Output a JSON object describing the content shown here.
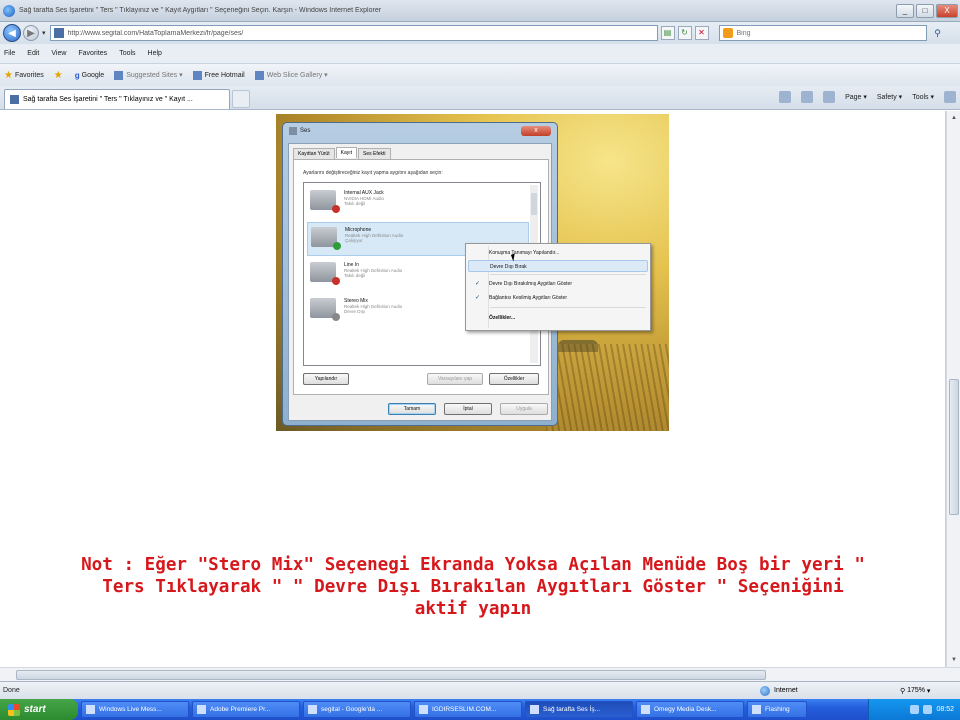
{
  "window": {
    "title": "Sağ tarafta Ses İşaretini \" Ters \" Tıklayınız ve \" Kayıt Aygıtları \" Seçeneğini Seçin. Karşın - Windows Internet Explorer",
    "minimize": "_",
    "maximize": "□",
    "close": "X"
  },
  "address": {
    "url": "http://www.segital.com/HataToplamaMerkezi/fr/page/ses/",
    "search_placeholder": "Bing"
  },
  "menu": [
    "File",
    "Edit",
    "View",
    "Favorites",
    "Tools",
    "Help"
  ],
  "favorites": {
    "label": "Favorites",
    "items": [
      "Google",
      "Suggested Sites ▾",
      "Free Hotmail",
      "Web Slice Gallery ▾"
    ]
  },
  "tab": {
    "label": "Sağ tarafta Ses İşaretini \" Ters \" Tıklayınız ve \" Kayıt ..."
  },
  "commands": [
    "Page ▾",
    "Safety ▾",
    "Tools ▾"
  ],
  "dialog": {
    "title": "Ses",
    "tabs": [
      "Kayıttan Yürüt",
      "Kayıt",
      "Ses Efekti"
    ],
    "instruction": "Ayarlarını değiştireceğiniz kayıt yapma aygıtını aşağıdan seçin:",
    "devices": [
      {
        "name": "Internal AUX Jack",
        "line1": "NVIDIA HDMI Audio",
        "line2": "Takılı değil",
        "status": "red"
      },
      {
        "name": "Microphone",
        "line1": "Realtek High Definition Audio",
        "line2": "Çalışıyor",
        "status": "ok"
      },
      {
        "name": "Line In",
        "line1": "Realtek High Definition Audio",
        "line2": "Takılı değil",
        "status": "red"
      },
      {
        "name": "Stereo Mix",
        "line1": "Realtek High Definition Audio",
        "line2": "Devre Dışı",
        "status": "none"
      }
    ],
    "btn_configure": "Yapılandır",
    "btn_default": "Varsayılanı yap",
    "btn_properties": "Özellikler",
    "btn_ok": "Tamam",
    "btn_cancel": "İptal",
    "btn_apply": "Uygula"
  },
  "context_menu": {
    "items": [
      {
        "label": "Konuşma Tanımayı Yapılandır...",
        "checked": false
      },
      {
        "label": "Devre Dışı Bırak",
        "checked": false
      },
      {
        "label": "Devre Dışı Bırakılmış Aygıtları Göster",
        "checked": true
      },
      {
        "label": "Bağlantısı Kesilmiş Aygıtları Göster",
        "checked": true
      },
      {
        "label": "Özellikler...",
        "checked": false
      }
    ]
  },
  "note": {
    "line1": "Not : Eğer  \"Stero Mix\" Seçenegi Ekranda Yoksa  Açılan Menüde Boş bir yeri \"",
    "line2": "Ters Tıklayarak \"  \" Devre Dışı Bırakılan Aygıtları Göster \" Seçeniğini",
    "line3": "aktif yapın",
    "color": "#d6181c"
  },
  "status": {
    "text": "Done",
    "zone": "Internet",
    "zoom": "175%"
  },
  "taskbar": {
    "start": "start",
    "tasks": [
      "Windows Live Mess...",
      "Adobe Premiere Pr...",
      "segital - Google'da ...",
      "IGDIRSESLIM.COM...",
      "Sağ tarafta Ses İş...",
      "Omegy Media Desk...",
      "Flashing"
    ],
    "time": "08:52"
  }
}
